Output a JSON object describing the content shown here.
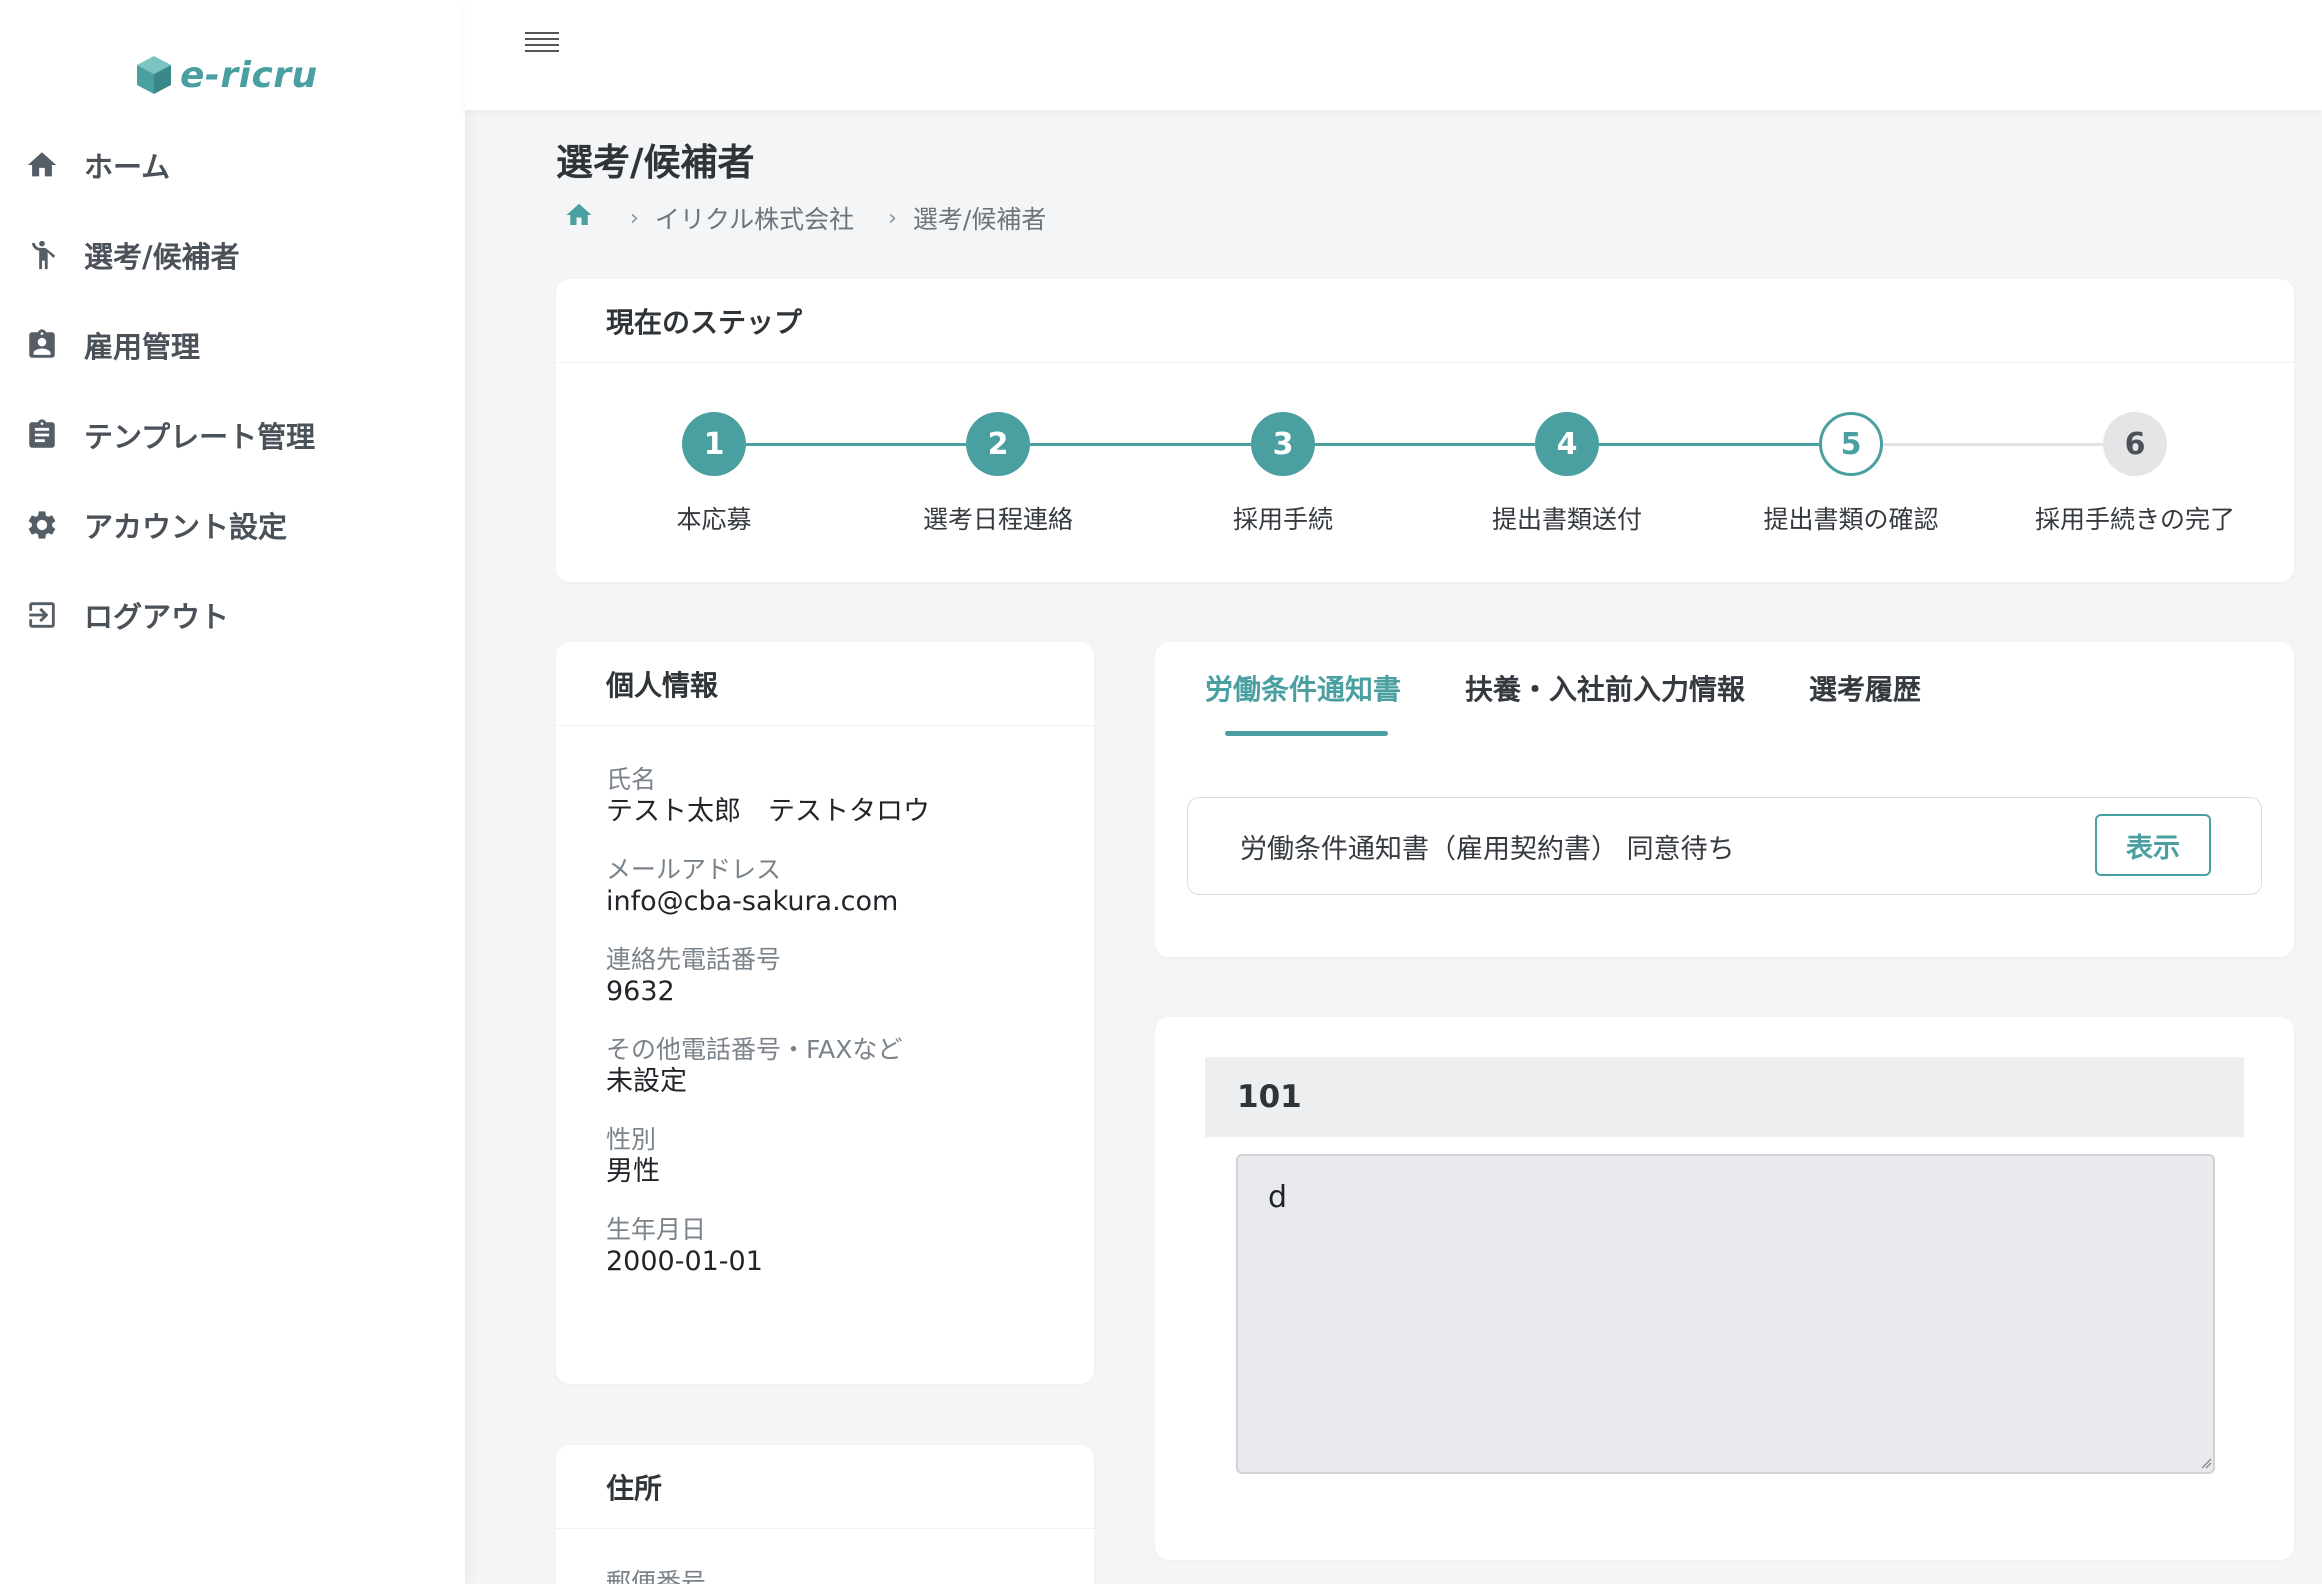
{
  "app": {
    "logo_text": "e-ricru",
    "colors": {
      "accent": "#4a9fa0",
      "sidebar_bg": "#ffffff",
      "page_bg": "#f4f5f7"
    }
  },
  "sidebar": {
    "items": [
      {
        "label": "ホーム",
        "icon": "home-icon"
      },
      {
        "label": "選考/候補者",
        "icon": "person-icon"
      },
      {
        "label": "雇用管理",
        "icon": "badge-icon"
      },
      {
        "label": "テンプレート管理",
        "icon": "clipboard-icon"
      },
      {
        "label": "アカウント設定",
        "icon": "gear-icon"
      },
      {
        "label": "ログアウト",
        "icon": "logout-icon"
      }
    ]
  },
  "header": {
    "title": "選考/候補者",
    "breadcrumb": [
      "イリクル株式会社",
      "選考/候補者"
    ]
  },
  "steps_card": {
    "title": "現在のステップ",
    "steps": [
      {
        "number": "1",
        "label": "本応募",
        "status": "done"
      },
      {
        "number": "2",
        "label": "選考日程連絡",
        "status": "done"
      },
      {
        "number": "3",
        "label": "採用手続",
        "status": "done"
      },
      {
        "number": "4",
        "label": "提出書類送付",
        "status": "done"
      },
      {
        "number": "5",
        "label": "提出書類の確認",
        "status": "current"
      },
      {
        "number": "6",
        "label": "採用手続きの完了",
        "status": "todo"
      }
    ]
  },
  "personal_info": {
    "title": "個人情報",
    "fields": [
      {
        "label": "氏名",
        "value": "テスト太郎　テストタロウ"
      },
      {
        "label": "メールアドレス",
        "value": "info@cba-sakura.com"
      },
      {
        "label": "連絡先電話番号",
        "value": "9632"
      },
      {
        "label": "その他電話番号・FAXなど",
        "value": "未設定"
      },
      {
        "label": "性別",
        "value": "男性"
      },
      {
        "label": "生年月日",
        "value": "2000-01-01"
      }
    ]
  },
  "address": {
    "title": "住所",
    "first_label": "郵便番号"
  },
  "tabs": {
    "items": [
      "労働条件通知書",
      "扶養・入社前入力情報",
      "選考履歴"
    ],
    "active_index": 0,
    "notice_text": "労働条件通知書（雇用契約書） 同意待ち",
    "show_button": "表示"
  },
  "question": {
    "title": "101",
    "answer": "d"
  }
}
